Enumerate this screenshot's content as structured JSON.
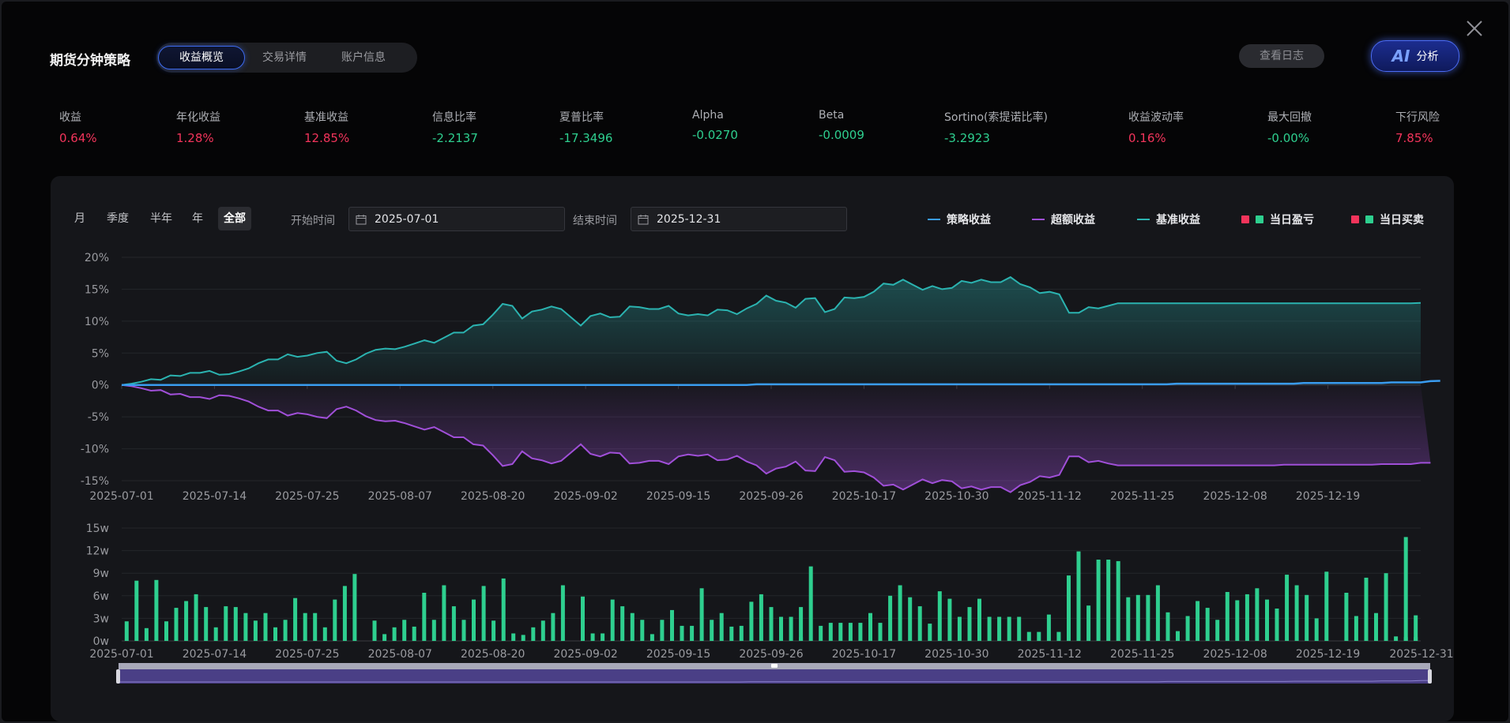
{
  "header": {
    "title": "期货分钟策略",
    "tabs": [
      "收益概览",
      "交易详情",
      "账户信息"
    ],
    "active_tab": 0,
    "log_button": "查看日志",
    "ai_button_logo": "AI",
    "ai_button_label": "分析",
    "close_icon": "close-icon"
  },
  "metrics": [
    {
      "label": "收益",
      "value": "0.64%",
      "color": "#f2345b"
    },
    {
      "label": "年化收益",
      "value": "1.28%",
      "color": "#f2345b"
    },
    {
      "label": "基准收益",
      "value": "12.85%",
      "color": "#f2345b"
    },
    {
      "label": "信息比率",
      "value": "-2.2137",
      "color": "#2ecf8f"
    },
    {
      "label": "夏普比率",
      "value": "-17.3496",
      "color": "#2ecf8f"
    },
    {
      "label": "Alpha",
      "value": "-0.0270",
      "color": "#2ecf8f"
    },
    {
      "label": "Beta",
      "value": "-0.0009",
      "color": "#2ecf8f"
    },
    {
      "label": "Sortino(索提诺比率)",
      "value": "-3.2923",
      "color": "#2ecf8f"
    },
    {
      "label": "收益波动率",
      "value": "0.16%",
      "color": "#f2345b"
    },
    {
      "label": "最大回撤",
      "value": "-0.00%",
      "color": "#2ecf8f"
    },
    {
      "label": "下行风险",
      "value": "7.85%",
      "color": "#f2345b"
    }
  ],
  "filters": {
    "ranges": [
      "月",
      "季度",
      "半年",
      "年",
      "全部"
    ],
    "active_range": 4,
    "start_label": "开始时间",
    "start_value": "2025-07-01",
    "end_label": "结束时间",
    "end_value": "2025-12-31",
    "calendar_icon": "calendar-icon"
  },
  "legend": [
    {
      "label": "策略收益",
      "kind": "line",
      "colors": [
        "#3a9cf0"
      ]
    },
    {
      "label": "超额收益",
      "kind": "line",
      "colors": [
        "#a04fd8"
      ]
    },
    {
      "label": "基准收益",
      "kind": "line",
      "colors": [
        "#2bb3b0"
      ]
    },
    {
      "label": "当日盈亏",
      "kind": "squares",
      "colors": [
        "#f2345b",
        "#2ecf8f"
      ]
    },
    {
      "label": "当日买卖",
      "kind": "squares",
      "colors": [
        "#f2345b",
        "#2ecf8f"
      ]
    }
  ],
  "chart_data": [
    {
      "type": "line",
      "x_start": "2025-07-01",
      "x_end": "2025-12-31",
      "x_ticks": [
        "2025-07-01",
        "2025-07-14",
        "2025-07-25",
        "2025-08-07",
        "2025-08-20",
        "2025-09-02",
        "2025-09-15",
        "2025-09-26",
        "2025-10-17",
        "2025-10-30",
        "2025-11-12",
        "2025-11-25",
        "2025-12-08",
        "2025-12-19"
      ],
      "y_ticks": [
        "20%",
        "15%",
        "10%",
        "5%",
        "0%",
        "-5%",
        "-10%",
        "-15%"
      ],
      "ylim": [
        -15,
        20
      ],
      "y_unit": "%",
      "grid": true,
      "series": [
        {
          "name": "基准收益",
          "color": "#2bb3b0",
          "values": [
            0.0,
            0.2,
            0.5,
            0.9,
            0.8,
            1.5,
            1.4,
            1.9,
            1.9,
            2.2,
            1.6,
            1.7,
            2.1,
            2.6,
            3.4,
            4.0,
            4.0,
            4.8,
            4.4,
            4.6,
            5.0,
            5.2,
            3.8,
            3.4,
            4.0,
            4.9,
            5.5,
            5.7,
            5.6,
            6.0,
            6.5,
            7.0,
            6.6,
            7.4,
            8.2,
            8.2,
            9.3,
            9.5,
            11.0,
            12.7,
            12.4,
            10.4,
            11.5,
            11.8,
            12.3,
            11.9,
            10.6,
            9.3,
            10.8,
            11.2,
            10.6,
            10.7,
            12.3,
            12.2,
            11.9,
            11.9,
            12.4,
            11.2,
            10.9,
            11.1,
            10.9,
            11.8,
            11.7,
            11.1,
            12.0,
            12.7,
            14.0,
            13.2,
            12.9,
            12.1,
            13.5,
            13.6,
            11.4,
            11.9,
            13.7,
            13.6,
            13.8,
            14.6,
            15.9,
            15.7,
            16.5,
            15.7,
            14.9,
            15.5,
            15.0,
            15.2,
            16.3,
            16.0,
            16.5,
            16.1,
            16.1,
            16.9,
            15.8,
            15.3,
            14.4,
            14.6,
            14.2,
            11.3,
            11.3,
            12.2,
            12.0,
            12.4,
            12.8,
            12.8,
            12.8,
            12.8,
            12.8,
            12.8,
            12.8,
            12.8,
            12.8,
            12.8,
            12.8,
            12.8,
            12.8,
            12.8,
            12.8,
            12.8,
            12.8,
            12.8,
            12.8,
            12.8,
            12.8,
            12.8,
            12.8,
            12.8,
            12.8,
            12.8,
            12.8,
            12.8,
            12.8,
            12.8,
            12.8,
            12.85
          ]
        },
        {
          "name": "策略收益",
          "color": "#3a9cf0",
          "values": [
            0.0,
            0.0,
            0.0,
            0.0,
            0.0,
            0.0,
            0.0,
            0.0,
            0.0,
            0.0,
            0.0,
            0.0,
            0.0,
            0.0,
            0.0,
            0.0,
            0.0,
            0.0,
            0.0,
            0.0,
            0.0,
            0.0,
            0.0,
            0.0,
            0.0,
            0.0,
            0.0,
            0.0,
            0.0,
            0.0,
            0.0,
            0.0,
            0.0,
            0.0,
            0.0,
            0.0,
            0.0,
            0.0,
            0.0,
            0.0,
            0.0,
            0.0,
            0.0,
            0.0,
            0.0,
            0.0,
            0.0,
            0.0,
            0.0,
            0.0,
            0.0,
            0.0,
            0.0,
            0.0,
            0.0,
            0.0,
            0.0,
            0.0,
            0.0,
            0.0,
            0.0,
            0.0,
            0.0,
            0.0,
            0.0,
            0.1,
            0.1,
            0.1,
            0.1,
            0.1,
            0.1,
            0.1,
            0.1,
            0.1,
            0.1,
            0.1,
            0.1,
            0.1,
            0.1,
            0.1,
            0.1,
            0.1,
            0.1,
            0.1,
            0.1,
            0.1,
            0.1,
            0.1,
            0.1,
            0.1,
            0.1,
            0.1,
            0.1,
            0.1,
            0.1,
            0.1,
            0.1,
            0.1,
            0.1,
            0.1,
            0.1,
            0.1,
            0.1,
            0.1,
            0.1,
            0.1,
            0.1,
            0.1,
            0.2,
            0.2,
            0.2,
            0.2,
            0.2,
            0.2,
            0.2,
            0.2,
            0.2,
            0.2,
            0.2,
            0.2,
            0.2,
            0.3,
            0.3,
            0.3,
            0.3,
            0.3,
            0.3,
            0.3,
            0.3,
            0.3,
            0.4,
            0.4,
            0.4,
            0.4,
            0.6,
            0.64
          ]
        },
        {
          "name": "超额收益",
          "color": "#a04fd8",
          "values": [
            0.0,
            -0.2,
            -0.5,
            -0.9,
            -0.8,
            -1.5,
            -1.4,
            -1.9,
            -1.9,
            -2.2,
            -1.6,
            -1.7,
            -2.1,
            -2.6,
            -3.4,
            -4.0,
            -4.0,
            -4.8,
            -4.4,
            -4.6,
            -5.0,
            -5.2,
            -3.8,
            -3.4,
            -4.0,
            -4.9,
            -5.5,
            -5.7,
            -5.6,
            -6.0,
            -6.5,
            -7.0,
            -6.6,
            -7.4,
            -8.2,
            -8.2,
            -9.3,
            -9.5,
            -11.0,
            -12.7,
            -12.4,
            -10.4,
            -11.5,
            -11.8,
            -12.3,
            -11.9,
            -10.6,
            -9.3,
            -10.8,
            -11.2,
            -10.6,
            -10.7,
            -12.3,
            -12.2,
            -11.9,
            -11.9,
            -12.4,
            -11.2,
            -10.9,
            -11.1,
            -10.9,
            -11.8,
            -11.7,
            -11.1,
            -12.0,
            -12.6,
            -13.9,
            -13.1,
            -12.8,
            -12.0,
            -13.4,
            -13.5,
            -11.3,
            -11.8,
            -13.6,
            -13.5,
            -13.7,
            -14.5,
            -15.8,
            -15.6,
            -16.4,
            -15.6,
            -14.8,
            -15.4,
            -14.9,
            -15.1,
            -16.2,
            -15.9,
            -16.4,
            -16.0,
            -16.0,
            -16.8,
            -15.7,
            -15.2,
            -14.3,
            -14.5,
            -14.1,
            -11.2,
            -11.2,
            -12.1,
            -11.9,
            -12.3,
            -12.6,
            -12.6,
            -12.6,
            -12.6,
            -12.6,
            -12.6,
            -12.6,
            -12.6,
            -12.6,
            -12.6,
            -12.6,
            -12.6,
            -12.6,
            -12.6,
            -12.6,
            -12.6,
            -12.6,
            -12.5,
            -12.5,
            -12.5,
            -12.5,
            -12.5,
            -12.5,
            -12.5,
            -12.5,
            -12.5,
            -12.5,
            -12.4,
            -12.4,
            -12.4,
            -12.4,
            -12.2,
            -12.21
          ]
        }
      ]
    },
    {
      "type": "bar",
      "x_ticks": [
        "2025-07-01",
        "2025-07-14",
        "2025-07-25",
        "2025-08-07",
        "2025-08-20",
        "2025-09-02",
        "2025-09-15",
        "2025-09-26",
        "2025-10-17",
        "2025-10-30",
        "2025-11-12",
        "2025-11-25",
        "2025-12-08",
        "2025-12-19",
        "2025-12-31"
      ],
      "y_ticks": [
        "15w",
        "12w",
        "9w",
        "6w",
        "3w",
        "0w"
      ],
      "ylim": [
        0,
        15
      ],
      "y_unit": "w",
      "grid": true,
      "series": [
        {
          "name": "当日买卖",
          "color": "#2ecf8f",
          "values": [
            2.6,
            8.0,
            1.7,
            8.1,
            2.6,
            4.4,
            5.3,
            6.2,
            4.5,
            1.8,
            4.6,
            4.5,
            3.7,
            2.7,
            3.7,
            1.8,
            2.8,
            5.7,
            3.7,
            3.7,
            1.8,
            5.5,
            7.3,
            8.9,
            0,
            2.7,
            0.9,
            1.8,
            2.8,
            1.9,
            6.4,
            2.8,
            7.4,
            4.6,
            2.8,
            5.5,
            7.3,
            2.7,
            8.3,
            1.0,
            0.8,
            1.8,
            2.7,
            3.7,
            7.4,
            0,
            5.9,
            1.0,
            1.0,
            5.5,
            4.6,
            3.7,
            2.8,
            0.9,
            2.8,
            4.1,
            2.0,
            2.0,
            7.0,
            2.8,
            3.7,
            1.9,
            2.0,
            5.2,
            6.2,
            4.5,
            3.2,
            3.2,
            4.5,
            9.9,
            2.0,
            2.4,
            2.4,
            2.4,
            2.4,
            3.7,
            2.4,
            6.0,
            7.4,
            5.8,
            4.6,
            2.3,
            6.6,
            5.6,
            3.2,
            4.5,
            5.6,
            3.2,
            3.2,
            3.2,
            3.2,
            1.2,
            1.2,
            3.5,
            1.2,
            8.7,
            11.9,
            4.7,
            10.8,
            10.8,
            10.6,
            5.8,
            6.1,
            6.1,
            7.4,
            3.8,
            1.3,
            3.3,
            5.3,
            4.4,
            2.8,
            6.5,
            5.4,
            6.2,
            7.0,
            5.5,
            4.3,
            8.8,
            7.4,
            6.1,
            3.0,
            9.2,
            0,
            6.4,
            3.3,
            8.4,
            3.7,
            9.0,
            0.6,
            13.8,
            3.4
          ]
        },
        {
          "name": "当日盈亏",
          "color": "#2ecf8f",
          "values": [
            0,
            0,
            0,
            0,
            0,
            0,
            0,
            0,
            0,
            0,
            0,
            0,
            0,
            0,
            0,
            0,
            0,
            0,
            0,
            0,
            0,
            0,
            0,
            0,
            0,
            0,
            0,
            0,
            0,
            0,
            0,
            0,
            0,
            0,
            0,
            0,
            0,
            0,
            0,
            0,
            0,
            0,
            0,
            0,
            0,
            0,
            0,
            0,
            0,
            0,
            0,
            0,
            0,
            0,
            0,
            0,
            0,
            0,
            0,
            0,
            0,
            0,
            0,
            0,
            0,
            0,
            0,
            0,
            0.5,
            0,
            0,
            0,
            0,
            0,
            0,
            0,
            0,
            0,
            0,
            0,
            0,
            0,
            0,
            0,
            0,
            0,
            0,
            0,
            0,
            0,
            0,
            0,
            0,
            0,
            0,
            0,
            0,
            0,
            0,
            0,
            0,
            0,
            0,
            0,
            0,
            0,
            0,
            0,
            0,
            0,
            0,
            0,
            0,
            0,
            0,
            0,
            0,
            0,
            0,
            0,
            0,
            0,
            0,
            0,
            0,
            0,
            0,
            0,
            0,
            0.5,
            0.5,
            0,
            0
          ]
        }
      ]
    }
  ]
}
